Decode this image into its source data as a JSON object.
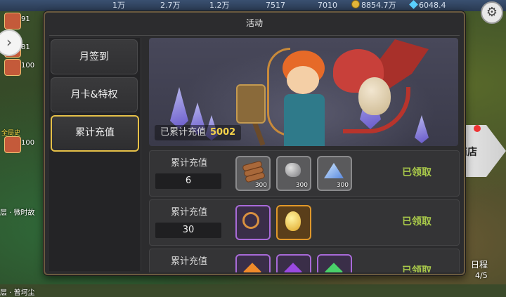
{
  "background": {
    "top_stats": [
      "1万",
      "2.7万",
      "1.2万",
      "7517",
      "7010",
      "8854.7万",
      "6048.4"
    ],
    "left_players": [
      "91",
      "81",
      "100",
      "100"
    ],
    "left_labels": [
      "全局史",
      "层 · 微时故",
      "层 · 普坷尘"
    ],
    "shop_label": "商店",
    "schedule_label": "日程",
    "schedule_count": "4/5"
  },
  "dialog": {
    "title": "活动",
    "nav": [
      {
        "label": "月签到",
        "active": false
      },
      {
        "label": "月卡&特权",
        "active": false
      },
      {
        "label": "累计充值",
        "active": true
      }
    ],
    "banner": {
      "total_label": "已累计充值",
      "total_value": "5002"
    },
    "rows": [
      {
        "label": "累计充值",
        "amount": "6",
        "status": "已领取",
        "items": [
          {
            "icon": "wood-logs-icon",
            "count": "300",
            "frame": "gray"
          },
          {
            "icon": "stone-ore-icon",
            "count": "300",
            "frame": "gray"
          },
          {
            "icon": "blue-crystal-icon",
            "count": "300",
            "frame": "gray"
          }
        ]
      },
      {
        "label": "累计充值",
        "amount": "30",
        "status": "已领取",
        "items": [
          {
            "icon": "golden-ring-icon",
            "count": "",
            "frame": "purple"
          },
          {
            "icon": "golden-egg-icon",
            "count": "",
            "frame": "orange"
          }
        ]
      },
      {
        "label": "累计充值",
        "amount": "",
        "status": "已领取",
        "items": [
          {
            "icon": "orange-gem-icon",
            "count": "",
            "frame": "purple"
          },
          {
            "icon": "purple-gem-icon",
            "count": "",
            "frame": "purple"
          },
          {
            "icon": "green-gem-icon",
            "count": "",
            "frame": "purple"
          }
        ]
      }
    ]
  },
  "colors": {
    "accent_gold": "#e5c048",
    "claimed_green": "#a8c84a",
    "total_value_yellow": "#f4d24a"
  }
}
